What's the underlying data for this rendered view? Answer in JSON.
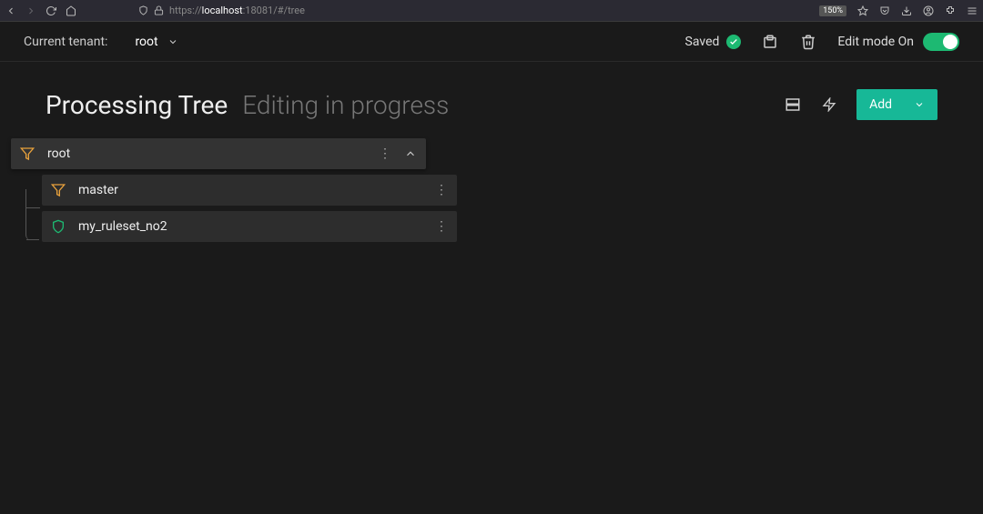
{
  "browser": {
    "url_prefix": "https://",
    "url_host": "localhost",
    "url_rest": ":18081/#/tree",
    "zoom": "150%"
  },
  "tenant": {
    "label": "Current tenant:",
    "value": "root"
  },
  "header": {
    "saved": "Saved",
    "edit_mode": "Edit mode On"
  },
  "page": {
    "title": "Processing Tree",
    "subtitle": "Editing in progress",
    "add": "Add"
  },
  "tree": {
    "root": {
      "label": "root",
      "icon": "funnel"
    },
    "children": [
      {
        "label": "master",
        "icon": "funnel"
      },
      {
        "label": "my_ruleset_no2",
        "icon": "shield"
      }
    ]
  }
}
